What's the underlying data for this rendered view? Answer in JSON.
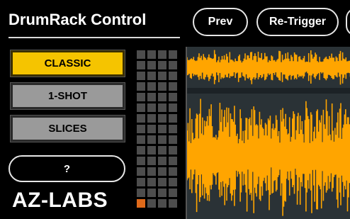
{
  "header": {
    "title": "DrumRack Control"
  },
  "toolbar": {
    "prev_label": "Prev",
    "retrigger_label": "Re-Trigger"
  },
  "modes": [
    {
      "label": "CLASSIC",
      "active": true
    },
    {
      "label": "1-SHOT",
      "active": false
    },
    {
      "label": "SLICES",
      "active": false
    }
  ],
  "help": {
    "label": "?"
  },
  "brand": {
    "label": "AZ-LABS"
  },
  "pads": {
    "rows": 15,
    "cols": 4,
    "active_row": 14,
    "active_col": 0
  },
  "colors": {
    "accent": "#f5c400",
    "waveform": "#ffa500",
    "pad_active": "#e06a1a",
    "pad_idle": "#4d4d4d",
    "wave_bg": "#2a3236"
  }
}
